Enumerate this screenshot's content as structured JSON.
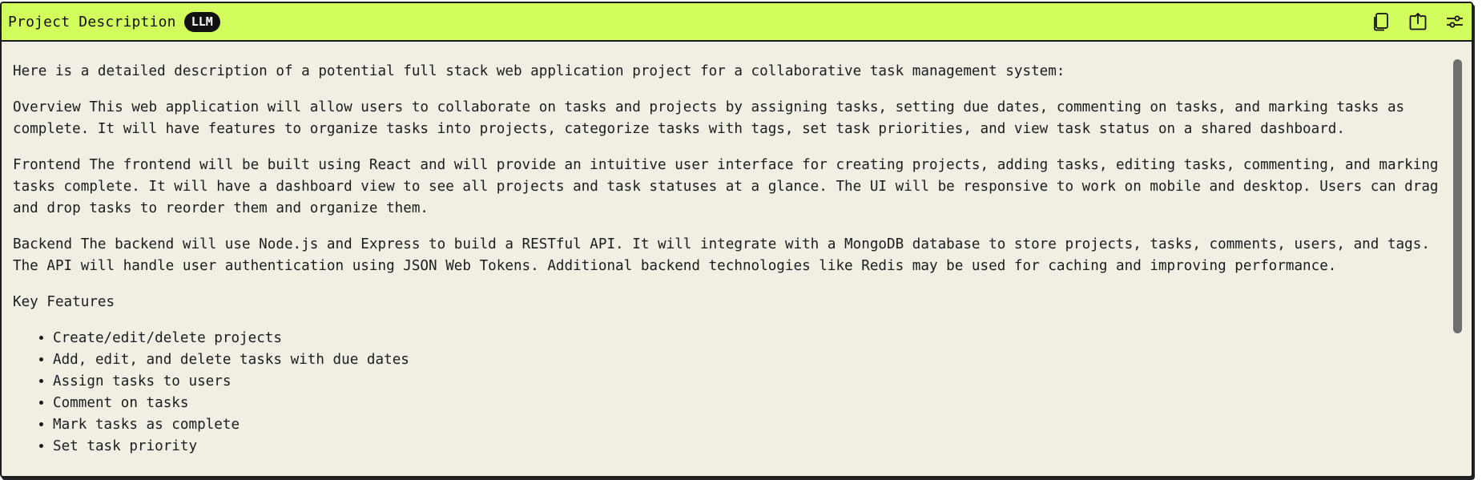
{
  "header": {
    "title": "Project Description",
    "badge": "LLM",
    "icons": [
      "copy-icon",
      "export-icon",
      "settings-sliders-icon"
    ]
  },
  "content": {
    "intro": "Here is a detailed description of a potential full stack web application project for a collaborative task management system:",
    "overview": "Overview This web application will allow users to collaborate on tasks and projects by assigning tasks, setting due dates, commenting on tasks, and marking tasks as complete. It will have features to organize tasks into projects, categorize tasks with tags, set task priorities, and view task status on a shared dashboard.",
    "frontend": "Frontend The frontend will be built using React and will provide an intuitive user interface for creating projects, adding tasks, editing tasks, commenting, and marking tasks complete. It will have a dashboard view to see all projects and task statuses at a glance. The UI will be responsive to work on mobile and desktop. Users can drag and drop tasks to reorder them and organize them.",
    "backend": "Backend The backend will use Node.js and Express to build a RESTful API. It will integrate with a MongoDB database to store projects, tasks, comments, users, and tags. The API will handle user authentication using JSON Web Tokens. Additional backend technologies like Redis may be used for caching and improving performance.",
    "key_features_heading": "Key Features",
    "features": [
      "Create/edit/delete projects",
      "Add, edit, and delete tasks with due dates",
      "Assign tasks to users",
      "Comment on tasks",
      "Mark tasks as complete",
      "Set task priority"
    ]
  },
  "colors": {
    "header_bg": "#d3fd5d",
    "panel_bg": "#f1efe4",
    "badge_bg": "#111111"
  }
}
